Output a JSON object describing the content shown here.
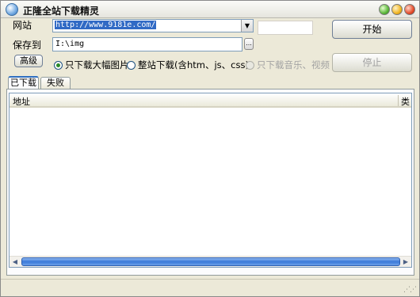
{
  "window": {
    "title": "正隆全站下载精灵"
  },
  "form": {
    "site_label": "网站",
    "site_value": "http://www.9181e.com/",
    "save_label": "保存到",
    "save_value": "I:\\img",
    "browse_label": "...",
    "advanced_label": "高级"
  },
  "buttons": {
    "start": "开始",
    "stop": "停止"
  },
  "options": [
    {
      "label": "只下载大幅图片",
      "selected": true,
      "enabled": true
    },
    {
      "label": "整站下载(含htm、js、css)",
      "selected": false,
      "enabled": true
    },
    {
      "label": "只下载音乐、视频",
      "selected": false,
      "enabled": false
    }
  ],
  "tabs": [
    {
      "label": "已下载",
      "active": true
    },
    {
      "label": "失败",
      "active": false
    }
  ],
  "list": {
    "columns": [
      "地址",
      "类"
    ]
  },
  "icons": {
    "combo_arrow": "chevron-down-icon",
    "scroll_left": "arrow-left-icon",
    "scroll_right": "arrow-right-icon"
  }
}
